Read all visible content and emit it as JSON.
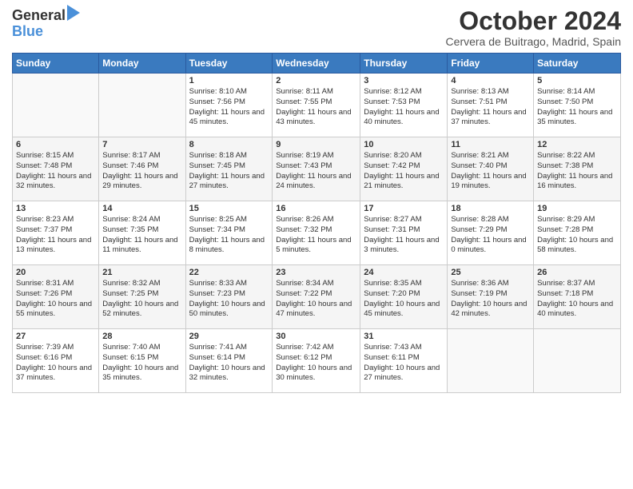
{
  "header": {
    "logo_line1": "General",
    "logo_line2": "Blue",
    "month_title": "October 2024",
    "location": "Cervera de Buitrago, Madrid, Spain"
  },
  "days_of_week": [
    "Sunday",
    "Monday",
    "Tuesday",
    "Wednesday",
    "Thursday",
    "Friday",
    "Saturday"
  ],
  "weeks": [
    [
      {
        "day": "",
        "info": ""
      },
      {
        "day": "",
        "info": ""
      },
      {
        "day": "1",
        "info": "Sunrise: 8:10 AM\nSunset: 7:56 PM\nDaylight: 11 hours and 45 minutes."
      },
      {
        "day": "2",
        "info": "Sunrise: 8:11 AM\nSunset: 7:55 PM\nDaylight: 11 hours and 43 minutes."
      },
      {
        "day": "3",
        "info": "Sunrise: 8:12 AM\nSunset: 7:53 PM\nDaylight: 11 hours and 40 minutes."
      },
      {
        "day": "4",
        "info": "Sunrise: 8:13 AM\nSunset: 7:51 PM\nDaylight: 11 hours and 37 minutes."
      },
      {
        "day": "5",
        "info": "Sunrise: 8:14 AM\nSunset: 7:50 PM\nDaylight: 11 hours and 35 minutes."
      }
    ],
    [
      {
        "day": "6",
        "info": "Sunrise: 8:15 AM\nSunset: 7:48 PM\nDaylight: 11 hours and 32 minutes."
      },
      {
        "day": "7",
        "info": "Sunrise: 8:17 AM\nSunset: 7:46 PM\nDaylight: 11 hours and 29 minutes."
      },
      {
        "day": "8",
        "info": "Sunrise: 8:18 AM\nSunset: 7:45 PM\nDaylight: 11 hours and 27 minutes."
      },
      {
        "day": "9",
        "info": "Sunrise: 8:19 AM\nSunset: 7:43 PM\nDaylight: 11 hours and 24 minutes."
      },
      {
        "day": "10",
        "info": "Sunrise: 8:20 AM\nSunset: 7:42 PM\nDaylight: 11 hours and 21 minutes."
      },
      {
        "day": "11",
        "info": "Sunrise: 8:21 AM\nSunset: 7:40 PM\nDaylight: 11 hours and 19 minutes."
      },
      {
        "day": "12",
        "info": "Sunrise: 8:22 AM\nSunset: 7:38 PM\nDaylight: 11 hours and 16 minutes."
      }
    ],
    [
      {
        "day": "13",
        "info": "Sunrise: 8:23 AM\nSunset: 7:37 PM\nDaylight: 11 hours and 13 minutes."
      },
      {
        "day": "14",
        "info": "Sunrise: 8:24 AM\nSunset: 7:35 PM\nDaylight: 11 hours and 11 minutes."
      },
      {
        "day": "15",
        "info": "Sunrise: 8:25 AM\nSunset: 7:34 PM\nDaylight: 11 hours and 8 minutes."
      },
      {
        "day": "16",
        "info": "Sunrise: 8:26 AM\nSunset: 7:32 PM\nDaylight: 11 hours and 5 minutes."
      },
      {
        "day": "17",
        "info": "Sunrise: 8:27 AM\nSunset: 7:31 PM\nDaylight: 11 hours and 3 minutes."
      },
      {
        "day": "18",
        "info": "Sunrise: 8:28 AM\nSunset: 7:29 PM\nDaylight: 11 hours and 0 minutes."
      },
      {
        "day": "19",
        "info": "Sunrise: 8:29 AM\nSunset: 7:28 PM\nDaylight: 10 hours and 58 minutes."
      }
    ],
    [
      {
        "day": "20",
        "info": "Sunrise: 8:31 AM\nSunset: 7:26 PM\nDaylight: 10 hours and 55 minutes."
      },
      {
        "day": "21",
        "info": "Sunrise: 8:32 AM\nSunset: 7:25 PM\nDaylight: 10 hours and 52 minutes."
      },
      {
        "day": "22",
        "info": "Sunrise: 8:33 AM\nSunset: 7:23 PM\nDaylight: 10 hours and 50 minutes."
      },
      {
        "day": "23",
        "info": "Sunrise: 8:34 AM\nSunset: 7:22 PM\nDaylight: 10 hours and 47 minutes."
      },
      {
        "day": "24",
        "info": "Sunrise: 8:35 AM\nSunset: 7:20 PM\nDaylight: 10 hours and 45 minutes."
      },
      {
        "day": "25",
        "info": "Sunrise: 8:36 AM\nSunset: 7:19 PM\nDaylight: 10 hours and 42 minutes."
      },
      {
        "day": "26",
        "info": "Sunrise: 8:37 AM\nSunset: 7:18 PM\nDaylight: 10 hours and 40 minutes."
      }
    ],
    [
      {
        "day": "27",
        "info": "Sunrise: 7:39 AM\nSunset: 6:16 PM\nDaylight: 10 hours and 37 minutes."
      },
      {
        "day": "28",
        "info": "Sunrise: 7:40 AM\nSunset: 6:15 PM\nDaylight: 10 hours and 35 minutes."
      },
      {
        "day": "29",
        "info": "Sunrise: 7:41 AM\nSunset: 6:14 PM\nDaylight: 10 hours and 32 minutes."
      },
      {
        "day": "30",
        "info": "Sunrise: 7:42 AM\nSunset: 6:12 PM\nDaylight: 10 hours and 30 minutes."
      },
      {
        "day": "31",
        "info": "Sunrise: 7:43 AM\nSunset: 6:11 PM\nDaylight: 10 hours and 27 minutes."
      },
      {
        "day": "",
        "info": ""
      },
      {
        "day": "",
        "info": ""
      }
    ]
  ]
}
